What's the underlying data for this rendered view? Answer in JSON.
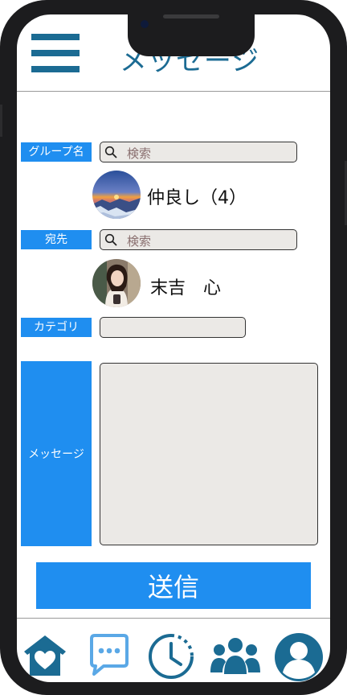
{
  "header": {
    "title": "メッセージ"
  },
  "form": {
    "group_label": "グループ名",
    "group_search_placeholder": "検索",
    "group_selected": "仲良し（4）",
    "recipient_label": "宛先",
    "recipient_search_placeholder": "検索",
    "recipient_selected": "末吉　心",
    "category_label": "カテゴリ",
    "category_value": "",
    "message_label": "メッセージ",
    "message_value": "",
    "send_label": "送信"
  },
  "tab_bar": {
    "items": [
      {
        "icon": "home-heart-icon"
      },
      {
        "icon": "chat-icon",
        "active": true
      },
      {
        "icon": "clock-icon"
      },
      {
        "icon": "group-icon"
      },
      {
        "icon": "user-profile-icon"
      }
    ]
  },
  "colors": {
    "brand_dark": "#1b6b93",
    "accent_blue": "#1f8ef0",
    "field_bg": "#ebe9e6",
    "chat_icon": "#5aa8e6"
  }
}
